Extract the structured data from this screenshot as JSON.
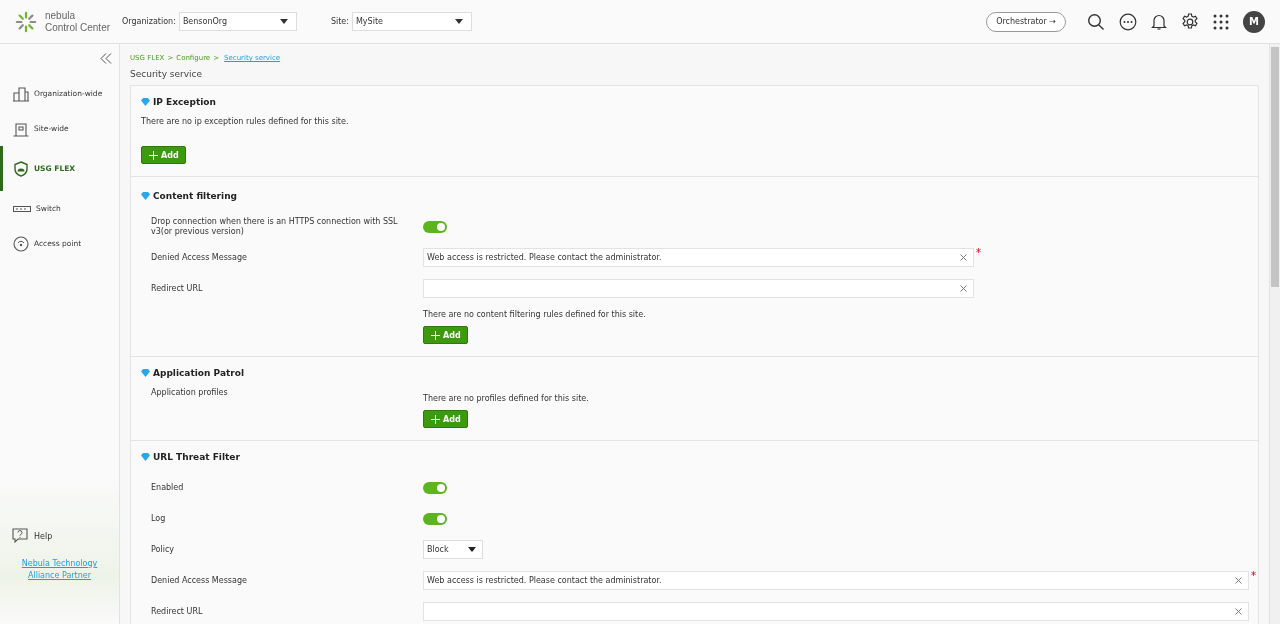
{
  "header": {
    "logo_line1": "nebula",
    "logo_line2": "Control Center",
    "org_label": "Organization:",
    "org_value": "BensonOrg",
    "site_label": "Site:",
    "site_value": "MySite",
    "orchestrator": "Orchestrator →",
    "avatar": "M"
  },
  "sidebar": {
    "items": [
      {
        "label": "Organization-wide",
        "selected": false
      },
      {
        "label": "Site-wide",
        "selected": false
      },
      {
        "label": "USG FLEX",
        "selected": true
      },
      {
        "label": "Switch",
        "selected": false
      },
      {
        "label": "Access point",
        "selected": false
      }
    ],
    "help": "Help",
    "partner_link": "Nebula Technology Alliance Partner"
  },
  "breadcrumb": {
    "separator": ">",
    "items": [
      {
        "label": "USG FLEX",
        "link": false
      },
      {
        "label": "Configure",
        "link": false
      },
      {
        "label": "Security service",
        "link": true
      }
    ]
  },
  "page_title": "Security service",
  "sections": [
    {
      "title": "IP Exception",
      "kind": "plain",
      "rows": [
        {
          "kind": "note",
          "text": "There are no ip exception rules defined for this site."
        },
        {
          "kind": "add",
          "text": "Add"
        }
      ]
    },
    {
      "title": "Content filtering",
      "kind": "form",
      "rows": [
        {
          "kind": "toggle",
          "label": "Drop connection when there is an HTTPS connection with SSL v3(or previous version)",
          "on": true
        },
        {
          "kind": "input",
          "label": "Denied Access Message",
          "value": "Web access is restricted. Please contact the administrator.",
          "required": true,
          "wide": false
        },
        {
          "kind": "input",
          "label": "Redirect URL",
          "value": "",
          "wide": false
        },
        {
          "kind": "note",
          "text": "There are no content filtering rules defined for this site."
        },
        {
          "kind": "add",
          "text": "Add"
        }
      ]
    },
    {
      "title": "Application Patrol",
      "kind": "form",
      "rows": [
        {
          "kind": "note",
          "label": "Application profiles",
          "text": "There are no profiles defined for this site."
        },
        {
          "kind": "add",
          "text": "Add"
        }
      ]
    },
    {
      "title": "URL Threat Filter",
      "kind": "form",
      "rows": [
        {
          "kind": "toggle",
          "label": "Enabled",
          "on": true
        },
        {
          "kind": "toggle",
          "label": "Log",
          "on": true
        },
        {
          "kind": "select",
          "label": "Policy",
          "value": "Block"
        },
        {
          "kind": "input",
          "label": "Denied Access Message",
          "value": "Web access is restricted. Please contact the administrator.",
          "required": true,
          "wide": true
        },
        {
          "kind": "input",
          "label": "Redirect URL",
          "value": "",
          "wide": true
        }
      ]
    }
  ]
}
